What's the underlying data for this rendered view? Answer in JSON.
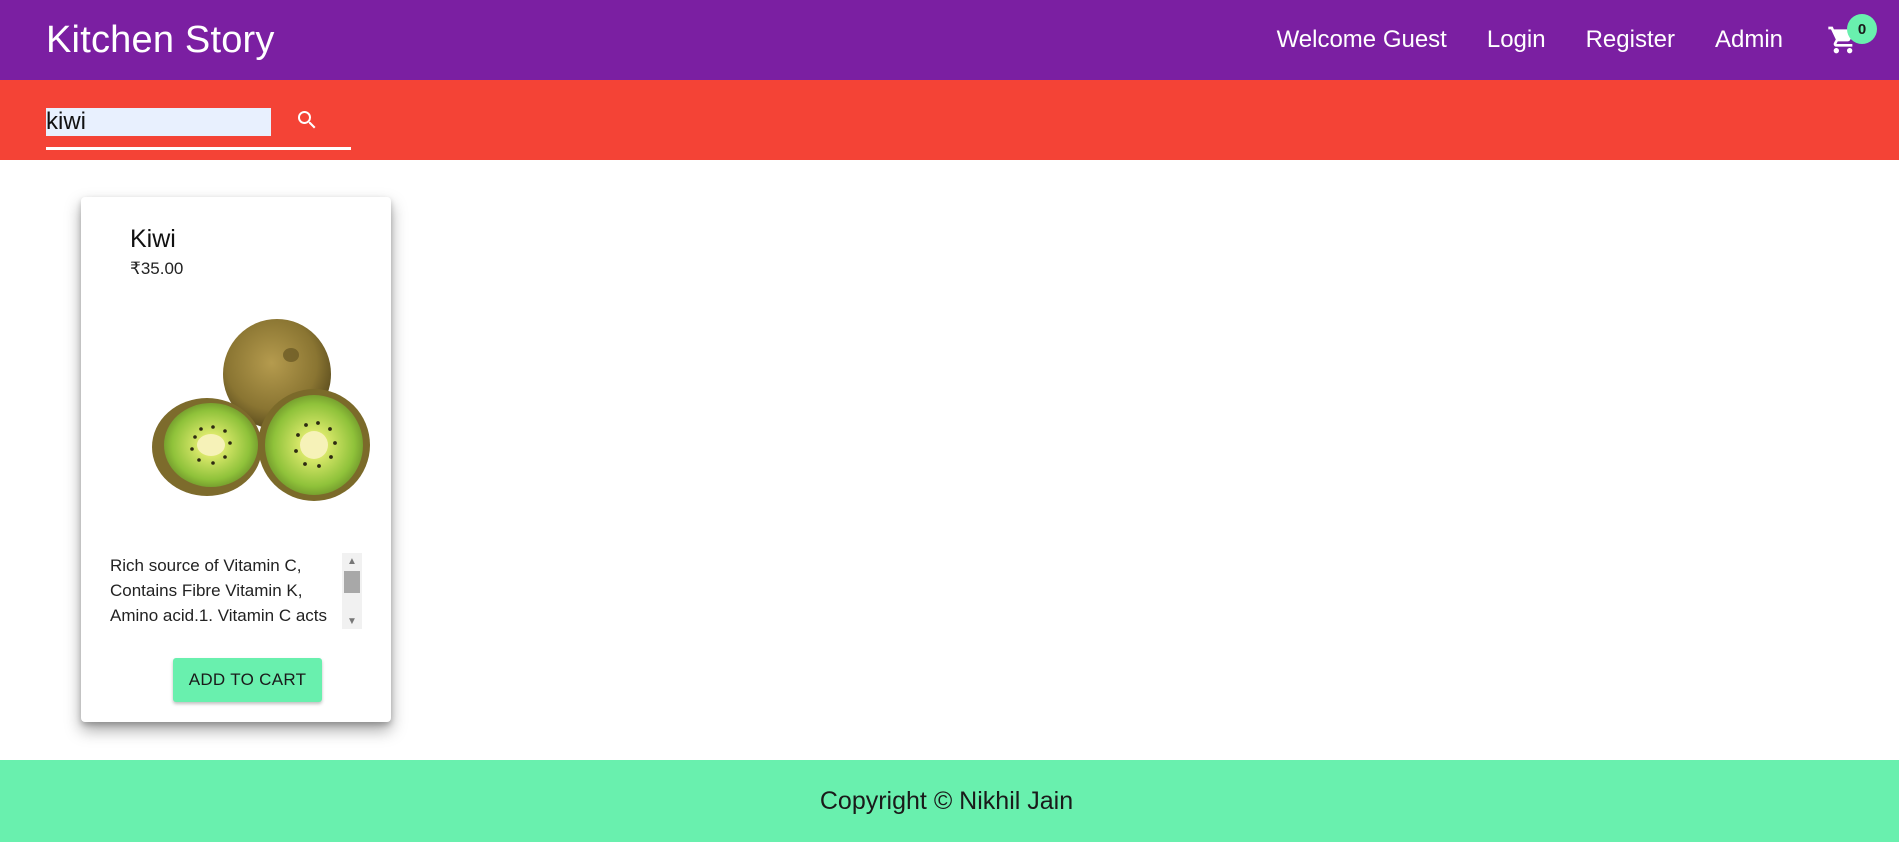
{
  "header": {
    "brand": "Kitchen Story",
    "nav": {
      "welcome": "Welcome Guest",
      "login": "Login",
      "register": "Register",
      "admin": "Admin"
    },
    "cart_icon": "shopping-cart-icon",
    "cart_count": "0"
  },
  "search": {
    "value": "kiwi",
    "icon": "search-icon"
  },
  "products": [
    {
      "name": "Kiwi",
      "price": "₹35.00",
      "description": "Rich source of Vitamin C, Contains Fibre Vitamin K, Amino acid.1. Vitamin C acts",
      "add_to_cart_label": "ADD TO CART"
    }
  ],
  "footer": {
    "copyright": "Copyright © Nikhil Jain"
  },
  "colors": {
    "header_bg": "#7b1fa2",
    "search_bg": "#f44336",
    "accent": "#69f0ae"
  }
}
